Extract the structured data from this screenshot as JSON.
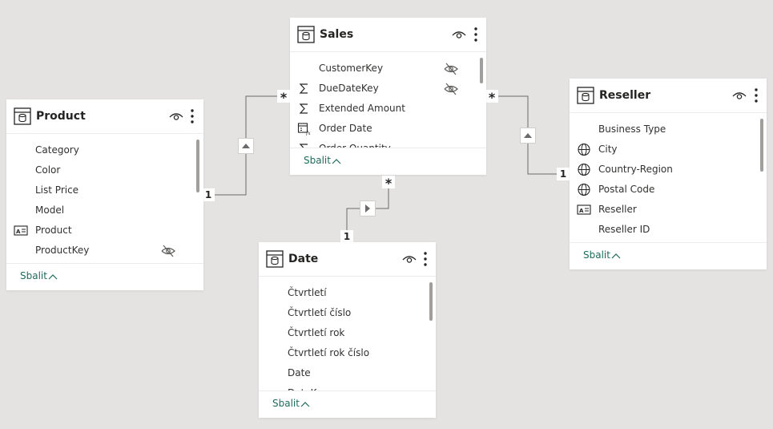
{
  "tables": {
    "sales": {
      "title": "Sales",
      "fields": [
        {
          "name": "CustomerKey",
          "icon": "none",
          "hidden": true
        },
        {
          "name": "DueDateKey",
          "icon": "sigma-icon",
          "hidden": true
        },
        {
          "name": "Extended Amount",
          "icon": "sigma-icon",
          "hidden": false
        },
        {
          "name": "Order Date",
          "icon": "date-hierarchy-icon",
          "hidden": false
        },
        {
          "name": "Order Quantity",
          "icon": "sigma-icon",
          "hidden": false
        }
      ],
      "collapse_label": "Sbalit"
    },
    "product": {
      "title": "Product",
      "fields": [
        {
          "name": "Category",
          "icon": "none",
          "hidden": false
        },
        {
          "name": "Color",
          "icon": "none",
          "hidden": false
        },
        {
          "name": "List Price",
          "icon": "none",
          "hidden": false
        },
        {
          "name": "Model",
          "icon": "none",
          "hidden": false
        },
        {
          "name": "Product",
          "icon": "label-icon",
          "hidden": false
        },
        {
          "name": "ProductKey",
          "icon": "none",
          "hidden": true
        }
      ],
      "collapse_label": "Sbalit"
    },
    "reseller": {
      "title": "Reseller",
      "fields": [
        {
          "name": "Business Type",
          "icon": "none",
          "hidden": false
        },
        {
          "name": "City",
          "icon": "globe-icon",
          "hidden": false
        },
        {
          "name": "Country-Region",
          "icon": "globe-icon",
          "hidden": false
        },
        {
          "name": "Postal Code",
          "icon": "globe-icon",
          "hidden": false
        },
        {
          "name": "Reseller",
          "icon": "label-icon",
          "hidden": false
        },
        {
          "name": "Reseller ID",
          "icon": "none",
          "hidden": false
        }
      ],
      "collapse_label": "Sbalit"
    },
    "date": {
      "title": "Date",
      "fields": [
        {
          "name": "Čtvrtletí",
          "icon": "none",
          "hidden": false
        },
        {
          "name": "Čtvrtletí číslo",
          "icon": "none",
          "hidden": false
        },
        {
          "name": "Čtvrtletí rok",
          "icon": "none",
          "hidden": false
        },
        {
          "name": "Čtvrtletí rok číslo",
          "icon": "none",
          "hidden": false
        },
        {
          "name": "Date",
          "icon": "none",
          "hidden": false
        },
        {
          "name": "DateKey",
          "icon": "none",
          "hidden": false
        }
      ],
      "collapse_label": "Sbalit"
    }
  },
  "relationships": {
    "product_sales": {
      "from_card": "1",
      "to_card": "*"
    },
    "reseller_sales": {
      "from_card": "1",
      "to_card": "*"
    },
    "date_sales": {
      "from_card": "1",
      "to_card": "*"
    }
  },
  "colors": {
    "background": "#e4e3e2",
    "accent": "#1f6b5c",
    "line": "#6b6a69"
  }
}
